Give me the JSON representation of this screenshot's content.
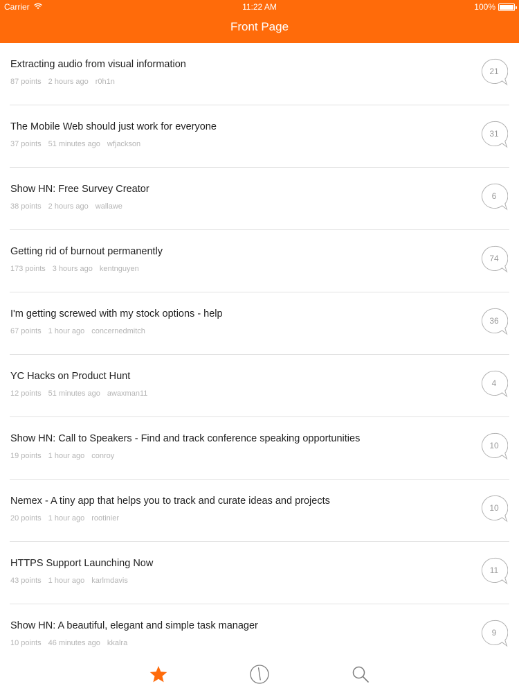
{
  "status_bar": {
    "carrier": "Carrier",
    "time": "11:22 AM",
    "battery": "100%"
  },
  "nav": {
    "title": "Front Page"
  },
  "stories": [
    {
      "title": "Extracting audio from visual information",
      "points": "87 points",
      "age": "2 hours ago",
      "user": "r0h1n",
      "comments": "21"
    },
    {
      "title": "The Mobile Web should just work for everyone",
      "points": "37 points",
      "age": "51 minutes ago",
      "user": "wfjackson",
      "comments": "31"
    },
    {
      "title": "Show HN: Free Survey Creator",
      "points": "38 points",
      "age": "2 hours ago",
      "user": "wallawe",
      "comments": "6"
    },
    {
      "title": "Getting rid of burnout permanently",
      "points": "173 points",
      "age": "3 hours ago",
      "user": "kentnguyen",
      "comments": "74"
    },
    {
      "title": "I'm getting screwed with my stock options - help",
      "points": "67 points",
      "age": "1 hour ago",
      "user": "concernedmitch",
      "comments": "36"
    },
    {
      "title": "YC Hacks on Product Hunt",
      "points": "12 points",
      "age": "51 minutes ago",
      "user": "awaxman11",
      "comments": "4"
    },
    {
      "title": "Show HN: Call to Speakers - Find and track conference speaking opportunities",
      "points": "19 points",
      "age": "1 hour ago",
      "user": "conroy",
      "comments": "10"
    },
    {
      "title": "Nemex - A tiny app that helps you to track and curate ideas and projects",
      "points": "20 points",
      "age": "1 hour ago",
      "user": "rootinier",
      "comments": "10"
    },
    {
      "title": "HTTPS Support Launching Now",
      "points": "43 points",
      "age": "1 hour ago",
      "user": "karlmdavis",
      "comments": "11"
    },
    {
      "title": "Show HN: A beautiful, elegant and simple task manager",
      "points": "10 points",
      "age": "46 minutes ago",
      "user": "kkalra",
      "comments": "9"
    }
  ],
  "tabbar": {
    "items": [
      {
        "icon": "star-icon",
        "active": true
      },
      {
        "icon": "clock-icon",
        "active": false
      },
      {
        "icon": "search-icon",
        "active": false
      }
    ]
  },
  "colors": {
    "accent": "#ff6b0a",
    "title_text": "#222222",
    "meta_text": "#b5b5b5",
    "bubble": "#b0b0b0"
  }
}
